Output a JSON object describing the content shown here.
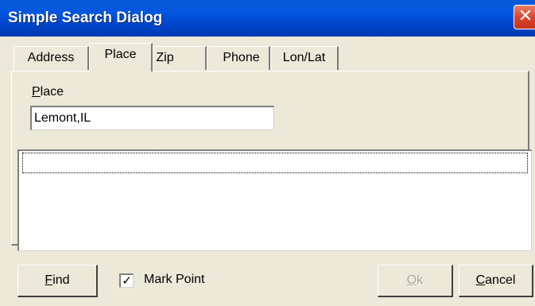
{
  "window": {
    "title": "Simple Search Dialog",
    "close_glyph": "✕"
  },
  "tabs": [
    {
      "label": "Address",
      "active": false
    },
    {
      "label": "Place",
      "active": true
    },
    {
      "label": "Zip",
      "active": false
    },
    {
      "label": "Phone",
      "active": false
    },
    {
      "label": "Lon/Lat",
      "active": false
    }
  ],
  "place": {
    "label_first": "P",
    "label_rest": "lace",
    "value": "Lemont,IL"
  },
  "results": {
    "items": []
  },
  "buttons": {
    "find_first": "F",
    "find_rest": "ind",
    "ok_first": "O",
    "ok_rest": "k",
    "cancel_first": "C",
    "cancel_rest": "ancel"
  },
  "mark_point": {
    "label": "Mark Point",
    "checked": true,
    "check_glyph": "✓"
  }
}
